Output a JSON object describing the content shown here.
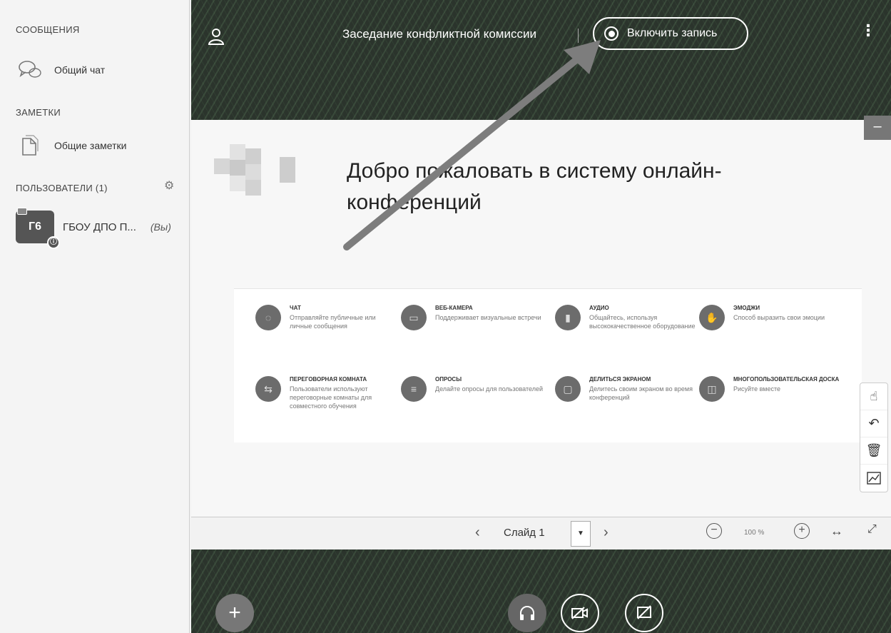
{
  "sidebar": {
    "messages_title": "СООБЩЕНИЯ",
    "public_chat": "Общий чат",
    "notes_title": "ЗАМЕТКИ",
    "shared_notes": "Общие заметки",
    "users_title": "ПОЛЬЗОВАТЕЛИ (1)",
    "user": {
      "initials": "Г6",
      "name": "ГБОУ ДПО П...",
      "you_label": "(Вы)"
    }
  },
  "header": {
    "meeting_title": "Заседание конфликтной комиссии",
    "record_label": "Включить запись",
    "menu_icon": "kebab-icon"
  },
  "slide": {
    "welcome": "Добро пожаловать в систему онлайн-конференций",
    "features": [
      {
        "title": "ЧАТ",
        "desc": "Отправляйте публичные или личные сообщения",
        "icon": "chat-icon"
      },
      {
        "title": "ВЕБ-КАМЕРА",
        "desc": "Поддерживает визуальные встречи",
        "icon": "camera-icon"
      },
      {
        "title": "АУДИО",
        "desc": "Общайтесь, используя высококачественное оборудование",
        "icon": "mic-icon"
      },
      {
        "title": "ЭМОДЖИ",
        "desc": "Способ выразить свои эмоции",
        "icon": "hand-icon"
      },
      {
        "title": "ПЕРЕГОВОРНАЯ КОМНАТА",
        "desc": "Пользователи используют переговорные комнаты для совместного обучения",
        "icon": "rooms-icon"
      },
      {
        "title": "ОПРОСЫ",
        "desc": "Делайте опросы для пользователей",
        "icon": "poll-icon"
      },
      {
        "title": "ДЕЛИТЬСЯ ЭКРАНОМ",
        "desc": "Делитесь своим экраном во время конференций",
        "icon": "screen-icon"
      },
      {
        "title": "МНОГОПОЛЬЗОВАТЕЛЬСКАЯ ДОСКА",
        "desc": "Рисуйте вместе",
        "icon": "whiteboard-icon"
      }
    ]
  },
  "nav": {
    "slide_label": "Слайд 1",
    "zoom": "100 %"
  },
  "colors": {
    "background": "#2b342c",
    "slide_bg": "#f7f7f7",
    "feature_icon": "#6c6c6c"
  }
}
